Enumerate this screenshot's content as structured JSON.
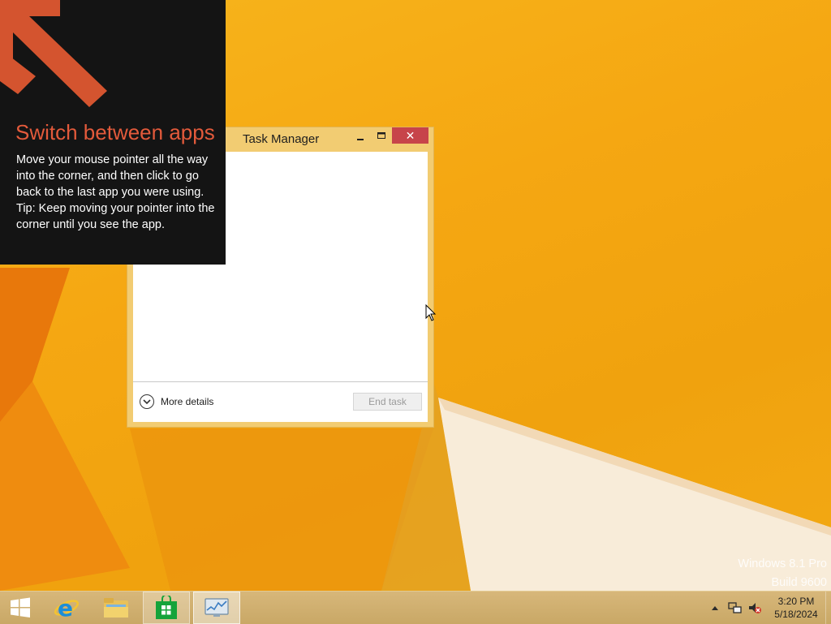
{
  "tip": {
    "title": "Switch between apps",
    "line1": "Move your mouse pointer all the way into the corner, and then click to go back to the last app you were using.",
    "line2": "Tip: Keep moving your pointer into the corner until you see the app.",
    "accent_color": "#e35a3b",
    "icon": "corner-arrow-icon"
  },
  "task_manager": {
    "title": "Task Manager",
    "minimize_icon": "minimize-icon",
    "maximize_icon": "maximize-icon",
    "close_label": "✕",
    "more_details_label": "More details",
    "end_task_label": "End task"
  },
  "watermark": {
    "line1": "Windows 8.1 Pro",
    "line2": "Build 9600"
  },
  "taskbar": {
    "items": [
      {
        "name": "Start",
        "icon": "windows-logo-icon"
      },
      {
        "name": "Internet Explorer",
        "icon": "internet-explorer-icon"
      },
      {
        "name": "File Explorer",
        "icon": "file-explorer-icon"
      },
      {
        "name": "Store",
        "icon": "store-icon"
      },
      {
        "name": "Task Manager",
        "icon": "task-manager-icon"
      }
    ],
    "tray": {
      "time": "3:20 PM",
      "date": "5/18/2024"
    }
  }
}
